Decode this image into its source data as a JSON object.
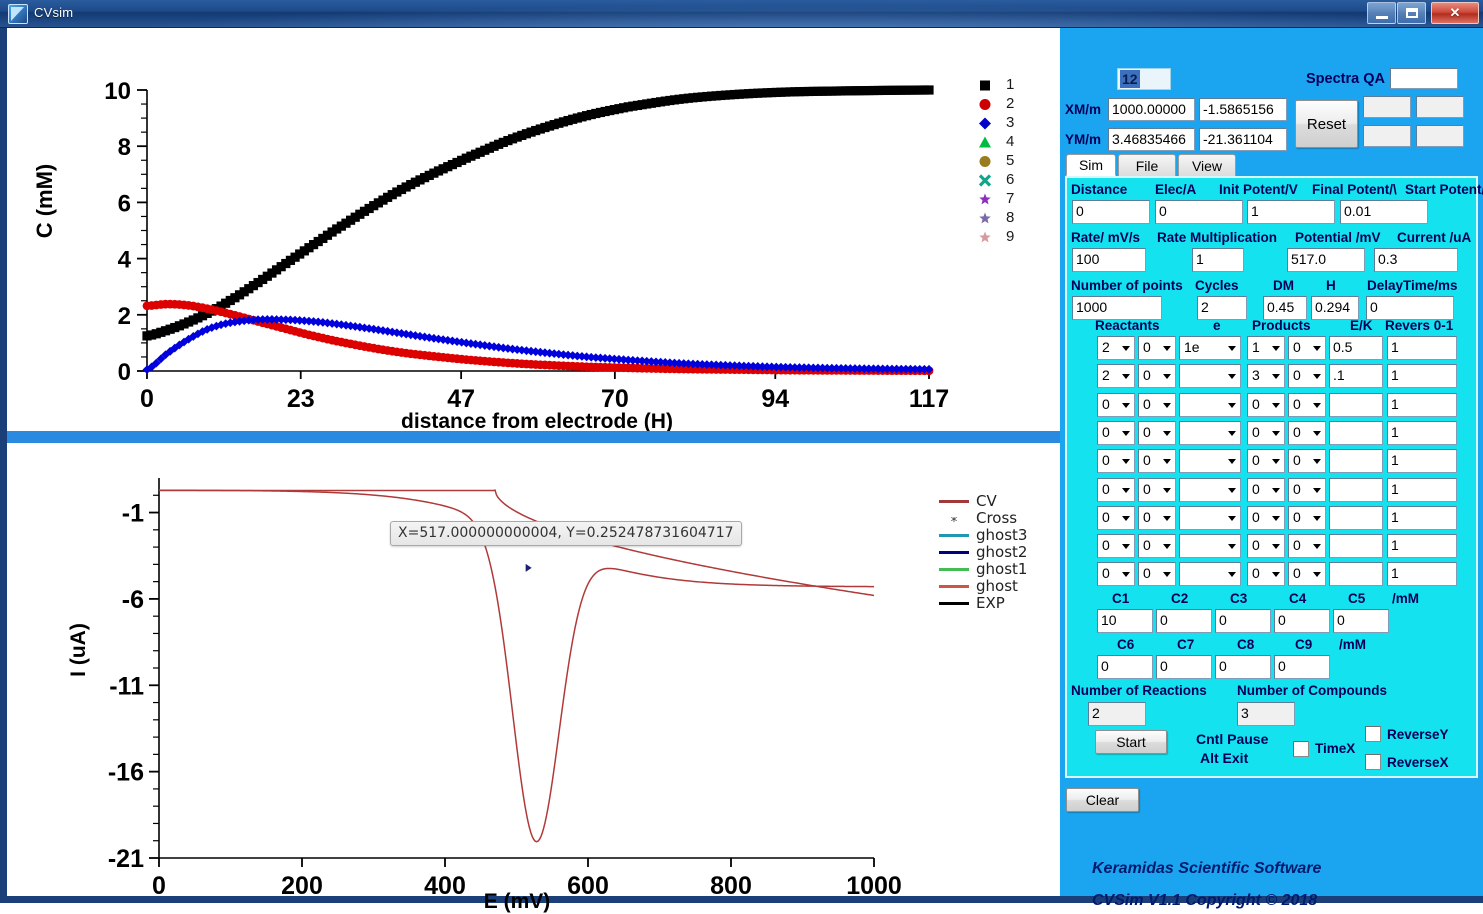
{
  "window": {
    "title": "CVsim",
    "icon": "app-icon",
    "buttons": {
      "minimize": "minimize",
      "maximize": "maximize",
      "close": "✕"
    }
  },
  "panel": {
    "id_value": "12",
    "spectra_qa_label": "Spectra QA",
    "spectra_qa_value": "",
    "xm_label": "XM/m",
    "xm_value": "1000.00000",
    "xm_value2": "-1.5865156",
    "ym_label": "YM/m",
    "ym_value": "3.46835466",
    "ym_value2": "-21.361104",
    "reset_label": "Reset",
    "extra_fields": [
      "",
      "",
      "",
      ""
    ],
    "tabs": [
      {
        "label": "Sim",
        "active": true
      },
      {
        "label": "File",
        "active": false
      },
      {
        "label": "View",
        "active": false
      }
    ],
    "row1": {
      "labels": [
        "Distance",
        "Elec/A",
        "Init Potent/V",
        "Final Potent/\\",
        "Start Potent/V"
      ],
      "values": [
        "0",
        "0",
        "1",
        "0.01"
      ]
    },
    "row2": {
      "labels": [
        "Rate/ mV/s",
        "Rate Multiplication",
        "Potential /mV",
        "Current /uA"
      ],
      "values": [
        "100",
        "1",
        "517.0",
        "0.3"
      ]
    },
    "row3": {
      "labels": [
        "Number of points",
        "Cycles",
        "DM",
        "H",
        "DelayTime/ms"
      ],
      "values": [
        "1000",
        "2",
        "0.45",
        "0.294",
        "0"
      ]
    },
    "reactions": {
      "headers": [
        "Reactants",
        "e",
        "Products",
        "E/K",
        "Revers 0-1"
      ],
      "rows": [
        {
          "r1": "2",
          "r2": "0",
          "e": "1e",
          "p1": "1",
          "p2": "0",
          "ek": "0.5",
          "rev": "1"
        },
        {
          "r1": "2",
          "r2": "0",
          "e": "",
          "p1": "3",
          "p2": "0",
          "ek": ".1",
          "rev": "1"
        },
        {
          "r1": "0",
          "r2": "0",
          "e": "",
          "p1": "0",
          "p2": "0",
          "ek": "",
          "rev": "1"
        },
        {
          "r1": "0",
          "r2": "0",
          "e": "",
          "p1": "0",
          "p2": "0",
          "ek": "",
          "rev": "1"
        },
        {
          "r1": "0",
          "r2": "0",
          "e": "",
          "p1": "0",
          "p2": "0",
          "ek": "",
          "rev": "1"
        },
        {
          "r1": "0",
          "r2": "0",
          "e": "",
          "p1": "0",
          "p2": "0",
          "ek": "",
          "rev": "1"
        },
        {
          "r1": "0",
          "r2": "0",
          "e": "",
          "p1": "0",
          "p2": "0",
          "ek": "",
          "rev": "1"
        },
        {
          "r1": "0",
          "r2": "0",
          "e": "",
          "p1": "0",
          "p2": "0",
          "ek": "",
          "rev": "1"
        },
        {
          "r1": "0",
          "r2": "0",
          "e": "",
          "p1": "0",
          "p2": "0",
          "ek": "",
          "rev": "1"
        }
      ]
    },
    "conc_top": {
      "labels": [
        "C1",
        "C2",
        "C3",
        "C4",
        "C5",
        "/mM"
      ],
      "values": [
        "10",
        "0",
        "0",
        "0",
        "0"
      ]
    },
    "conc_bottom": {
      "labels": [
        "C6",
        "C7",
        "C8",
        "C9",
        "/mM"
      ],
      "values": [
        "0",
        "0",
        "0",
        "0"
      ]
    },
    "counts": {
      "reactions_label": "Number of Reactions",
      "reactions_value": "2",
      "compounds_label": "Number of Compounds",
      "compounds_value": "3"
    },
    "start_label": "Start",
    "hint_line1": "Cntl Pause",
    "hint_line2": "Alt Exit",
    "timex_label": "TimeX",
    "reversey_label": "ReverseY",
    "reversex_label": "ReverseX",
    "clear_label": "Clear",
    "footer_line1": "Keramidas Scientific Software",
    "footer_line2": "CVSim V1.1 Copyright ©  2018"
  },
  "chart_data": [
    {
      "type": "scatter",
      "id": "concentration-profile",
      "title": "",
      "xlabel": "distance from electrode (H)",
      "ylabel": "C (mM)",
      "xticks": [
        "0",
        "23",
        "47",
        "70",
        "94",
        "117"
      ],
      "yticks": [
        "0",
        "2",
        "4",
        "6",
        "8",
        "10"
      ],
      "xlim": [
        0,
        117
      ],
      "ylim": [
        0,
        10
      ],
      "grid": false,
      "legend_position": "top-right",
      "legend": [
        "1",
        "2",
        "3",
        "4",
        "5",
        "6",
        "7",
        "8",
        "9"
      ],
      "legend_colors": [
        "#000000",
        "#cc0000",
        "#0000cc",
        "#00bb44",
        "#9a7b1e",
        "#14a38b",
        "#8b2fbf",
        "#7a6aa8",
        "#d79aa0"
      ],
      "legend_markers": [
        "square",
        "circle",
        "diamond",
        "triangle",
        "circle",
        "cross",
        "star",
        "star",
        "asterisk"
      ],
      "series": [
        {
          "name": "1",
          "color": "#000000",
          "marker": "square",
          "x": [
            0,
            3,
            6,
            9,
            12,
            16,
            20,
            24,
            28,
            33,
            38,
            43,
            48,
            54,
            60,
            66,
            72,
            80,
            88,
            96,
            105,
            117
          ],
          "y": [
            1.25,
            1.45,
            1.72,
            2.05,
            2.45,
            3.05,
            3.7,
            4.35,
            5.0,
            5.75,
            6.45,
            7.05,
            7.6,
            8.2,
            8.7,
            9.1,
            9.4,
            9.68,
            9.84,
            9.93,
            9.97,
            10.0
          ]
        },
        {
          "name": "2",
          "color": "#dd0000",
          "marker": "circle",
          "x": [
            0,
            3,
            6,
            9,
            12,
            16,
            20,
            24,
            28,
            33,
            38,
            43,
            48,
            54,
            60,
            66,
            72,
            80,
            88,
            96,
            105,
            117
          ],
          "y": [
            2.32,
            2.38,
            2.34,
            2.22,
            2.05,
            1.8,
            1.55,
            1.3,
            1.08,
            0.85,
            0.66,
            0.52,
            0.4,
            0.29,
            0.21,
            0.15,
            0.11,
            0.07,
            0.05,
            0.03,
            0.02,
            0.01
          ]
        },
        {
          "name": "3",
          "color": "#0000dd",
          "marker": "diamond",
          "x": [
            0,
            3,
            6,
            9,
            12,
            16,
            20,
            24,
            28,
            33,
            38,
            43,
            48,
            54,
            60,
            66,
            72,
            80,
            88,
            96,
            105,
            117
          ],
          "y": [
            0.05,
            0.62,
            1.1,
            1.48,
            1.7,
            1.82,
            1.83,
            1.78,
            1.68,
            1.52,
            1.34,
            1.16,
            0.99,
            0.8,
            0.64,
            0.5,
            0.39,
            0.27,
            0.19,
            0.13,
            0.09,
            0.06
          ]
        }
      ]
    },
    {
      "type": "line",
      "id": "cyclic-voltammogram",
      "title": "",
      "xlabel": "E (mV)",
      "ylabel": "I (uA)",
      "xticks": [
        "0",
        "200",
        "400",
        "600",
        "800",
        "1000"
      ],
      "yticks": [
        "-1",
        "-6",
        "-11",
        "-16",
        "-21"
      ],
      "xlim": [
        0,
        1000
      ],
      "ylim": [
        -21,
        1
      ],
      "grid": false,
      "legend_position": "right",
      "legend": [
        "CV",
        "Cross",
        "ghost3",
        "ghost2",
        "ghost1",
        "ghost",
        "EXP"
      ],
      "legend_colors": [
        "#a03a3a",
        "#333333",
        "#2196b0",
        "#000080",
        "#44bb55",
        "#cc5544",
        "#000000"
      ],
      "annotation": "X=517.000000000004, Y=0.252478731604717",
      "annotation_x": 517.0,
      "annotation_y": 0.252478731604717
    }
  ]
}
